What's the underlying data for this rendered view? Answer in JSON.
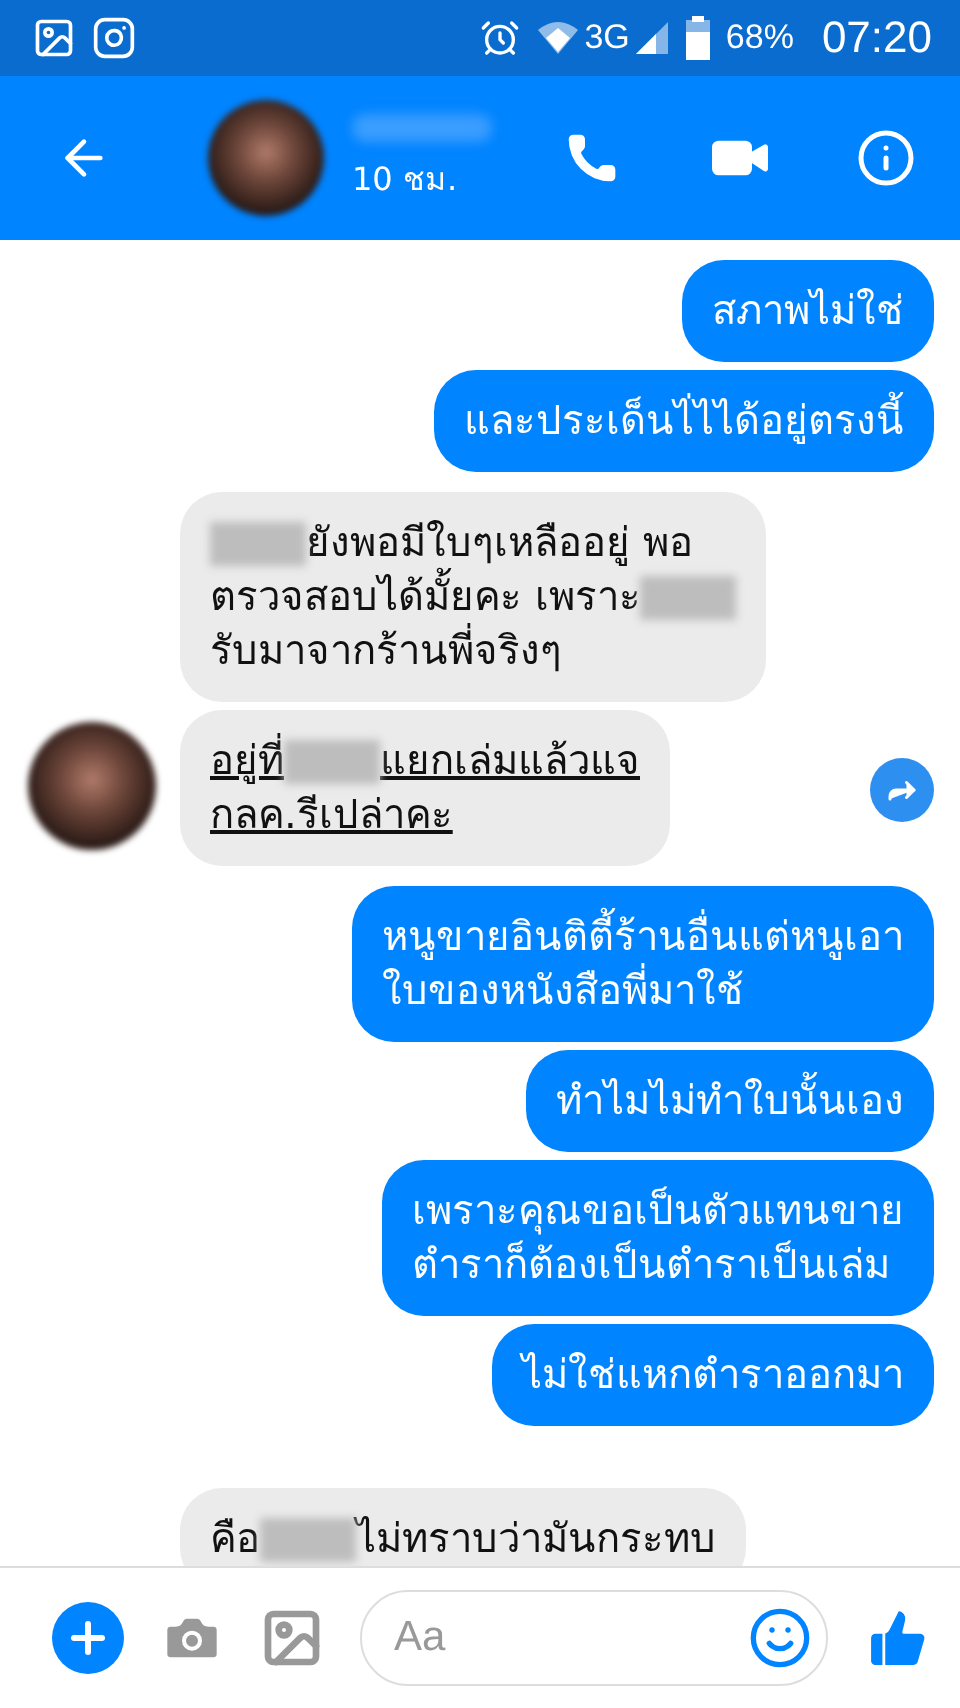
{
  "status_bar": {
    "network": "3G",
    "battery": "68%",
    "time": "07:20"
  },
  "header": {
    "status": "10 ชม."
  },
  "messages": [
    {
      "kind": "outgoing",
      "lines": [
        [
          {
            "kind": "text",
            "text": "สภาพไม่ใช่"
          }
        ]
      ]
    },
    {
      "kind": "outgoing",
      "lines": [
        [
          {
            "kind": "text",
            "text": "และประเด็นไ่ไได้อยู่ตรงนี้"
          }
        ]
      ]
    },
    {
      "kind": "incoming",
      "underline": false,
      "avatar": false,
      "forward": false,
      "lines": [
        [
          {
            "kind": "redacted"
          },
          {
            "kind": "text",
            "text": "ยังพอมีใบๆเหลืออยู่ พอ"
          }
        ],
        [
          {
            "kind": "text",
            "text": "ตรวจสอบได้มั้ยคะ เพราะ"
          },
          {
            "kind": "redacted"
          }
        ],
        [
          {
            "kind": "text",
            "text": "รับมาจากร้านพี่จริงๆ"
          }
        ]
      ]
    },
    {
      "kind": "incoming",
      "underline": true,
      "avatar": true,
      "forward": true,
      "lines": [
        [
          {
            "kind": "text",
            "text": "อยู่ที่"
          },
          {
            "kind": "redacted"
          },
          {
            "kind": "text",
            "text": "แยกเล่มแล้วแจ"
          }
        ],
        [
          {
            "kind": "text",
            "text": "กลค.รีเปล่าคะ"
          }
        ]
      ]
    },
    {
      "kind": "outgoing",
      "lines": [
        [
          {
            "kind": "text",
            "text": "หนูขายอินติตี้ร้านอื่นแต่หนูเอา"
          }
        ],
        [
          {
            "kind": "text",
            "text": "ใบของหนังสือพี่มาใช้"
          }
        ]
      ]
    },
    {
      "kind": "outgoing",
      "lines": [
        [
          {
            "kind": "text",
            "text": "ทำไมไม่ทำใบนั้นเอง"
          }
        ]
      ]
    },
    {
      "kind": "outgoing",
      "lines": [
        [
          {
            "kind": "text",
            "text": "เพราะคุณขอเป็นตัวแทนขาย"
          }
        ],
        [
          {
            "kind": "text",
            "text": "ตำราก็ต้องเป็นตำราเป็นเล่ม"
          }
        ]
      ]
    },
    {
      "kind": "outgoing",
      "lines": [
        [
          {
            "kind": "text",
            "text": "ไม่ใช่แหกตำราออกมา"
          }
        ]
      ]
    },
    {
      "kind": "incoming",
      "underline": false,
      "avatar": false,
      "forward": false,
      "lines": [
        [
          {
            "kind": "text",
            "text": "คือ"
          },
          {
            "kind": "redacted"
          },
          {
            "kind": "text",
            "text": "ไม่ทราบว่ามันกระทบ"
          }
        ]
      ]
    }
  ],
  "composer": {
    "placeholder": "Aa"
  }
}
